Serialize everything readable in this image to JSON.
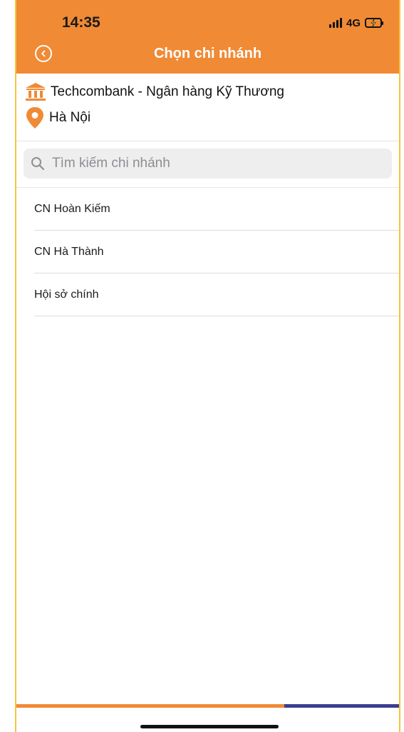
{
  "status_bar": {
    "time": "14:35",
    "network": "4G"
  },
  "header": {
    "title": "Chọn chi nhánh",
    "back_icon": "back-circle-icon"
  },
  "selection": {
    "bank_name": "Techcombank - Ngân hàng Kỹ Thương",
    "bank_icon": "bank-icon",
    "location": "Hà Nội",
    "location_icon": "location-pin-icon"
  },
  "search": {
    "placeholder": "Tìm kiếm chi nhánh",
    "value": ""
  },
  "branches": [
    {
      "label": "CN Hoàn Kiếm"
    },
    {
      "label": "CN Hà Thành"
    },
    {
      "label": "Hội sở chính"
    }
  ],
  "colors": {
    "accent": "#f08a35",
    "stripe_blue": "#3a3f8f",
    "frame": "#f7c43a"
  }
}
